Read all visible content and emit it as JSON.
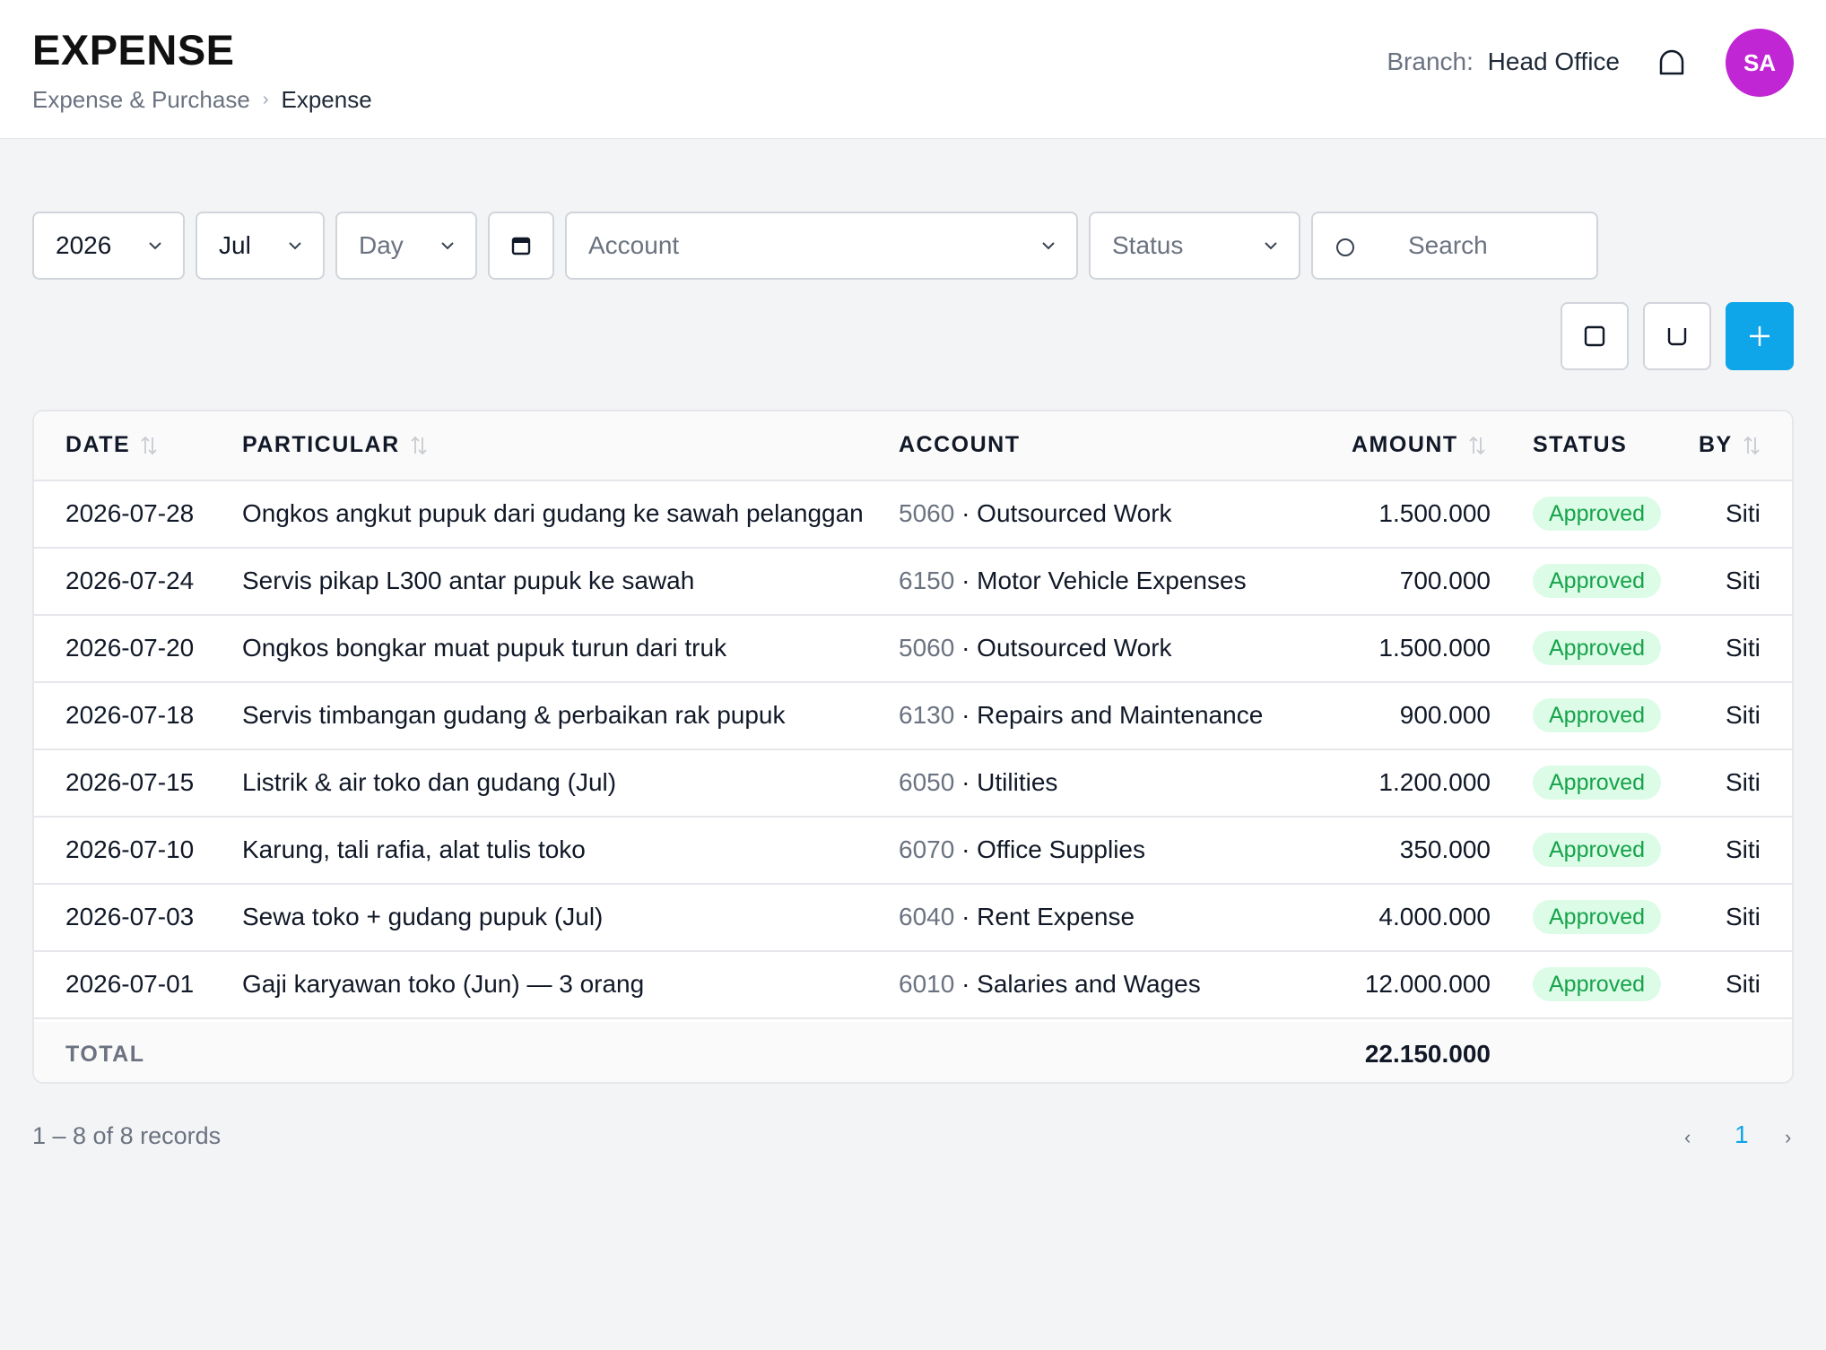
{
  "header": {
    "title": "EXPENSE",
    "breadcrumb": [
      "Expense & Purchase",
      "Expense"
    ],
    "branch_label": "Branch:",
    "branch_value": "Head Office",
    "avatar_initials": "SA"
  },
  "filters": {
    "year": "2026",
    "month": "Jul",
    "day_placeholder": "Day",
    "account_placeholder": "Account",
    "status_placeholder": "Status",
    "search_placeholder": "Search"
  },
  "colors": {
    "accent": "#0ea5e9",
    "avatar": "#c026d3",
    "approved_bg": "#dcfce7",
    "approved_text": "#16a34a"
  },
  "table": {
    "columns": [
      "DATE",
      "PARTICULAR",
      "ACCOUNT",
      "AMOUNT",
      "STATUS",
      "BY"
    ],
    "rows": [
      {
        "date": "2026-07-28",
        "particular": "Ongkos angkut pupuk dari gudang ke sawah pelanggan",
        "code": "5060",
        "account": "· Outsourced Work",
        "amount": "1.500.000",
        "status": "Approved",
        "by": "Siti"
      },
      {
        "date": "2026-07-24",
        "particular": "Servis pikap L300 antar pupuk ke sawah",
        "code": "6150",
        "account": "· Motor Vehicle Expenses",
        "amount": "700.000",
        "status": "Approved",
        "by": "Siti"
      },
      {
        "date": "2026-07-20",
        "particular": "Ongkos bongkar muat pupuk turun dari truk",
        "code": "5060",
        "account": "· Outsourced Work",
        "amount": "1.500.000",
        "status": "Approved",
        "by": "Siti"
      },
      {
        "date": "2026-07-18",
        "particular": "Servis timbangan gudang & perbaikan rak pupuk",
        "code": "6130",
        "account": "· Repairs and Maintenance",
        "amount": "900.000",
        "status": "Approved",
        "by": "Siti"
      },
      {
        "date": "2026-07-15",
        "particular": "Listrik & air toko dan gudang (Jul)",
        "code": "6050",
        "account": "· Utilities",
        "amount": "1.200.000",
        "status": "Approved",
        "by": "Siti"
      },
      {
        "date": "2026-07-10",
        "particular": "Karung, tali rafia, alat tulis toko",
        "code": "6070",
        "account": "· Office Supplies",
        "amount": "350.000",
        "status": "Approved",
        "by": "Siti"
      },
      {
        "date": "2026-07-03",
        "particular": "Sewa toko + gudang pupuk (Jul)",
        "code": "6040",
        "account": "· Rent Expense",
        "amount": "4.000.000",
        "status": "Approved",
        "by": "Siti"
      },
      {
        "date": "2026-07-01",
        "particular": "Gaji karyawan toko (Jun) — 3 orang",
        "code": "6010",
        "account": "· Salaries and Wages",
        "amount": "12.000.000",
        "status": "Approved",
        "by": "Siti"
      }
    ],
    "total_label": "TOTAL",
    "total_value": "22.150.000"
  },
  "pagination": {
    "records_text": "1 – 8 of 8 records",
    "prev": "‹",
    "current_page": "1",
    "next": "›"
  }
}
